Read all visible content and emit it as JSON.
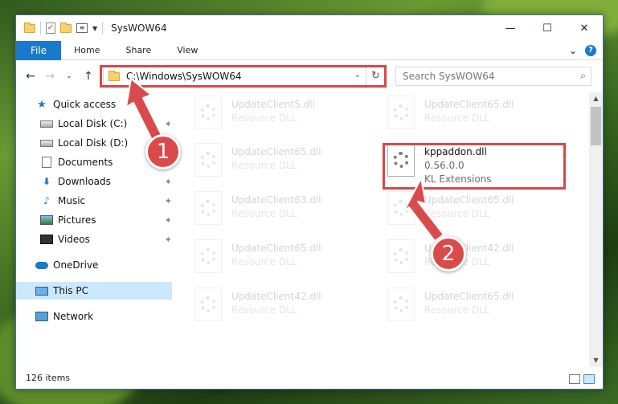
{
  "window": {
    "title": "SysWOW64",
    "controls": {
      "minimize": "—",
      "maximize": "☐",
      "close": "✕"
    }
  },
  "ribbon": {
    "tabs": [
      "File",
      "Home",
      "Share",
      "View"
    ],
    "expand": "⌄",
    "help": "?"
  },
  "nav": {
    "back": "←",
    "forward": "→",
    "recent": "⌄",
    "up": "↑",
    "address": "C:\\Windows\\SysWOW64",
    "address_chevron": "⌄",
    "refresh": "↻",
    "search_placeholder": "Search SysWOW64",
    "search_icon": "⌕"
  },
  "sidebar": {
    "items": [
      {
        "label": "Quick access",
        "icon": "star-icon",
        "pinned": false
      },
      {
        "label": "Local Disk (C:)",
        "icon": "disk-icon",
        "pinned": true
      },
      {
        "label": "Local Disk (D:)",
        "icon": "disk-icon",
        "pinned": false
      },
      {
        "label": "Documents",
        "icon": "document-icon",
        "pinned": true
      },
      {
        "label": "Downloads",
        "icon": "download-icon",
        "pinned": true
      },
      {
        "label": "Music",
        "icon": "music-icon",
        "pinned": true
      },
      {
        "label": "Pictures",
        "icon": "pictures-icon",
        "pinned": true
      },
      {
        "label": "Videos",
        "icon": "videos-icon",
        "pinned": true
      },
      {
        "label": "OneDrive",
        "icon": "cloud-icon",
        "pinned": false
      },
      {
        "label": "This PC",
        "icon": "pc-icon",
        "pinned": false,
        "selected": true
      },
      {
        "label": "Network",
        "icon": "network-icon",
        "pinned": false
      }
    ],
    "pin_glyph": "📌"
  },
  "files": {
    "left": [
      {
        "name": "UpdateClient5.dll",
        "type": "Resource DLL"
      },
      {
        "name": "UpdateClient65.dll",
        "type": "Resource DLL"
      },
      {
        "name": "UpdateClient63.dll",
        "type": "Resource DLL"
      },
      {
        "name": "UpdateClient65.dll",
        "type": "Resource DLL"
      },
      {
        "name": "UpdateClient42.dll",
        "type": "Resource DLL"
      }
    ],
    "right": [
      {
        "name": "UpdateClient65.dll",
        "type": "Resource DLL"
      },
      {
        "name": "kppaddon.dll",
        "version": "0.56.0.0",
        "type": "KL Extensions",
        "highlighted": true
      },
      {
        "name": "UpdateClient65.dll",
        "type": "Resource DLL"
      },
      {
        "name": "UpdateClient42.dll",
        "type": "Resource DLL"
      },
      {
        "name": "UpdateClient65.dll",
        "type": "Resource DLL"
      }
    ]
  },
  "status": {
    "count": "126 items"
  },
  "annotations": {
    "step1": "1",
    "step2": "2",
    "color": "#d94b4b"
  }
}
